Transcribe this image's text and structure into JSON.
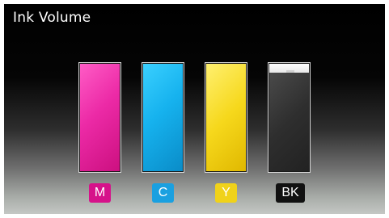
{
  "screen": {
    "title": "Ink Volume"
  },
  "cartridges": [
    {
      "name": "magenta",
      "label": "M",
      "level": 1.0,
      "label_color": "#d6128a",
      "ink_color": "#ec2aa6"
    },
    {
      "name": "cyan",
      "label": "C",
      "level": 1.0,
      "label_color": "#1aa0e0",
      "ink_color": "#16b2ee"
    },
    {
      "name": "yellow",
      "label": "Y",
      "level": 1.0,
      "label_color": "#f0d21a",
      "ink_color": "#f6d81c"
    },
    {
      "name": "black",
      "label": "BK",
      "level": 0.92,
      "label_color": "#111111",
      "ink_color": "#2e2e2e"
    }
  ]
}
